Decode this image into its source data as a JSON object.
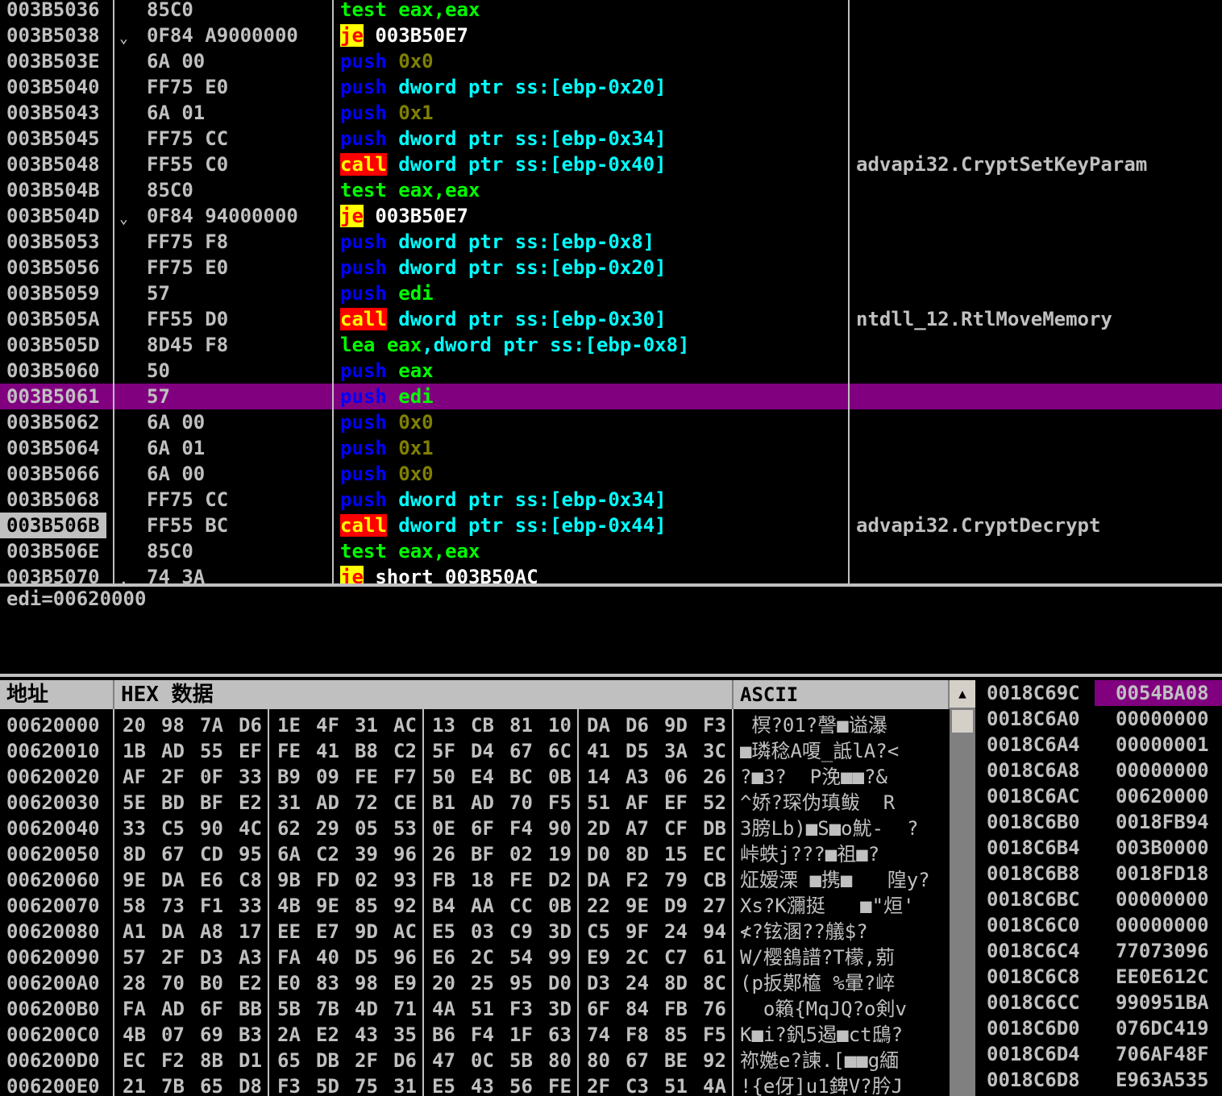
{
  "disasm": {
    "rows": [
      {
        "addr": "003B5036",
        "jmp": "",
        "hex": "85C0",
        "parts": [
          {
            "t": "test",
            "c": "op-test"
          },
          {
            "t": " "
          },
          {
            "t": "eax",
            "c": "reg"
          },
          {
            "t": ",",
            "c": "reg"
          },
          {
            "t": "eax",
            "c": "reg"
          }
        ],
        "comment": ""
      },
      {
        "addr": "003B5038",
        "jmp": "⌄",
        "hex": "0F84 A9000000",
        "parts": [
          {
            "t": "je",
            "c": "op-je"
          },
          {
            "t": " "
          },
          {
            "t": "003B50E7",
            "c": "lbl"
          }
        ],
        "comment": ""
      },
      {
        "addr": "003B503E",
        "jmp": "",
        "hex": "6A 00",
        "parts": [
          {
            "t": "push",
            "c": "op-push"
          },
          {
            "t": " "
          },
          {
            "t": "0x0",
            "c": "num"
          }
        ],
        "comment": ""
      },
      {
        "addr": "003B5040",
        "jmp": "",
        "hex": "FF75 E0",
        "parts": [
          {
            "t": "push",
            "c": "op-push"
          },
          {
            "t": " "
          },
          {
            "t": "dword ptr ss:[ebp-0x20]",
            "c": "mem"
          }
        ],
        "comment": ""
      },
      {
        "addr": "003B5043",
        "jmp": "",
        "hex": "6A 01",
        "parts": [
          {
            "t": "push",
            "c": "op-push"
          },
          {
            "t": " "
          },
          {
            "t": "0x1",
            "c": "num"
          }
        ],
        "comment": ""
      },
      {
        "addr": "003B5045",
        "jmp": "",
        "hex": "FF75 CC",
        "parts": [
          {
            "t": "push",
            "c": "op-push"
          },
          {
            "t": " "
          },
          {
            "t": "dword ptr ss:[ebp-0x34]",
            "c": "mem"
          }
        ],
        "comment": ""
      },
      {
        "addr": "003B5048",
        "jmp": "",
        "hex": "FF55 C0",
        "parts": [
          {
            "t": "call",
            "c": "op-call"
          },
          {
            "t": " "
          },
          {
            "t": "dword ptr ss:[ebp-0x40]",
            "c": "mem"
          }
        ],
        "comment": "advapi32.CryptSetKeyParam"
      },
      {
        "addr": "003B504B",
        "jmp": "",
        "hex": "85C0",
        "parts": [
          {
            "t": "test",
            "c": "op-test"
          },
          {
            "t": " "
          },
          {
            "t": "eax",
            "c": "reg"
          },
          {
            "t": ",",
            "c": "reg"
          },
          {
            "t": "eax",
            "c": "reg"
          }
        ],
        "comment": ""
      },
      {
        "addr": "003B504D",
        "jmp": "⌄",
        "hex": "0F84 94000000",
        "parts": [
          {
            "t": "je",
            "c": "op-je"
          },
          {
            "t": " "
          },
          {
            "t": "003B50E7",
            "c": "lbl"
          }
        ],
        "comment": ""
      },
      {
        "addr": "003B5053",
        "jmp": "",
        "hex": "FF75 F8",
        "parts": [
          {
            "t": "push",
            "c": "op-push"
          },
          {
            "t": " "
          },
          {
            "t": "dword ptr ss:[ebp-0x8]",
            "c": "mem"
          }
        ],
        "comment": ""
      },
      {
        "addr": "003B5056",
        "jmp": "",
        "hex": "FF75 E0",
        "parts": [
          {
            "t": "push",
            "c": "op-push"
          },
          {
            "t": " "
          },
          {
            "t": "dword ptr ss:[ebp-0x20]",
            "c": "mem"
          }
        ],
        "comment": ""
      },
      {
        "addr": "003B5059",
        "jmp": "",
        "hex": "57",
        "parts": [
          {
            "t": "push",
            "c": "op-push"
          },
          {
            "t": " "
          },
          {
            "t": "edi",
            "c": "reg"
          }
        ],
        "comment": ""
      },
      {
        "addr": "003B505A",
        "jmp": "",
        "hex": "FF55 D0",
        "parts": [
          {
            "t": "call",
            "c": "op-call"
          },
          {
            "t": " "
          },
          {
            "t": "dword ptr ss:[ebp-0x30]",
            "c": "mem"
          }
        ],
        "comment": "ntdll_12.RtlMoveMemory"
      },
      {
        "addr": "003B505D",
        "jmp": "",
        "hex": "8D45 F8",
        "parts": [
          {
            "t": "lea",
            "c": "op-lea"
          },
          {
            "t": " "
          },
          {
            "t": "eax",
            "c": "reg"
          },
          {
            "t": ",",
            "c": "mem"
          },
          {
            "t": "dword ptr ss:[ebp-0x8]",
            "c": "mem"
          }
        ],
        "comment": ""
      },
      {
        "addr": "003B5060",
        "jmp": "",
        "hex": "50",
        "parts": [
          {
            "t": "push",
            "c": "op-push"
          },
          {
            "t": " "
          },
          {
            "t": "eax",
            "c": "reg"
          }
        ],
        "comment": ""
      },
      {
        "addr": "003B5061",
        "jmp": "",
        "hex": "57",
        "parts": [
          {
            "t": "push",
            "c": "op-push"
          },
          {
            "t": " "
          },
          {
            "t": "edi",
            "c": "reg"
          }
        ],
        "comment": "",
        "selected": true
      },
      {
        "addr": "003B5062",
        "jmp": "",
        "hex": "6A 00",
        "parts": [
          {
            "t": "push",
            "c": "op-push"
          },
          {
            "t": " "
          },
          {
            "t": "0x0",
            "c": "num"
          }
        ],
        "comment": ""
      },
      {
        "addr": "003B5064",
        "jmp": "",
        "hex": "6A 01",
        "parts": [
          {
            "t": "push",
            "c": "op-push"
          },
          {
            "t": " "
          },
          {
            "t": "0x1",
            "c": "num"
          }
        ],
        "comment": ""
      },
      {
        "addr": "003B5066",
        "jmp": "",
        "hex": "6A 00",
        "parts": [
          {
            "t": "push",
            "c": "op-push"
          },
          {
            "t": " "
          },
          {
            "t": "0x0",
            "c": "num"
          }
        ],
        "comment": ""
      },
      {
        "addr": "003B5068",
        "jmp": "",
        "hex": "FF75 CC",
        "parts": [
          {
            "t": "push",
            "c": "op-push"
          },
          {
            "t": " "
          },
          {
            "t": "dword ptr ss:[ebp-0x34]",
            "c": "mem"
          }
        ],
        "comment": ""
      },
      {
        "addr": "003B506B",
        "jmp": "",
        "hex": "FF55 BC",
        "parts": [
          {
            "t": "call",
            "c": "op-call"
          },
          {
            "t": " "
          },
          {
            "t": "dword ptr ss:[ebp-0x44]",
            "c": "mem"
          }
        ],
        "comment": "advapi32.CryptDecrypt",
        "addr_highlight": true
      },
      {
        "addr": "003B506E",
        "jmp": "",
        "hex": "85C0",
        "parts": [
          {
            "t": "test",
            "c": "op-test"
          },
          {
            "t": " "
          },
          {
            "t": "eax",
            "c": "reg"
          },
          {
            "t": ",",
            "c": "reg"
          },
          {
            "t": "eax",
            "c": "reg"
          }
        ],
        "comment": ""
      },
      {
        "addr": "003B5070",
        "jmp": ".",
        "hex": "74 3A",
        "parts": [
          {
            "t": "je",
            "c": "op-je"
          },
          {
            "t": " "
          },
          {
            "t": "short 003B50AC",
            "c": "lbl"
          }
        ],
        "comment": ""
      }
    ]
  },
  "info": {
    "text": "edi=00620000"
  },
  "dump": {
    "headers": {
      "address": "地址",
      "hex": "HEX 数据",
      "ascii": "ASCII"
    },
    "rows": [
      {
        "addr": "00620000",
        "bytes": [
          "20",
          "98",
          "7A",
          "D6",
          "1E",
          "4F",
          "31",
          "AC",
          "13",
          "CB",
          "81",
          "10",
          "DA",
          "D6",
          "9D",
          "F3"
        ],
        "ascii": " 榠?01?謦■谥瀑"
      },
      {
        "addr": "00620010",
        "bytes": [
          "1B",
          "AD",
          "55",
          "EF",
          "FE",
          "41",
          "B8",
          "C2",
          "5F",
          "D4",
          "67",
          "6C",
          "41",
          "D5",
          "3A",
          "3C"
        ],
        "ascii": "■璘稔A嗄_詆lA?<"
      },
      {
        "addr": "00620020",
        "bytes": [
          "AF",
          "2F",
          "0F",
          "33",
          "B9",
          "09",
          "FE",
          "F7",
          "50",
          "E4",
          "BC",
          "0B",
          "14",
          "A3",
          "06",
          "26"
        ],
        "ascii": "?■3?  P浼■■?&"
      },
      {
        "addr": "00620030",
        "bytes": [
          "5E",
          "BD",
          "BF",
          "E2",
          "31",
          "AD",
          "72",
          "CE",
          "B1",
          "AD",
          "70",
          "F5",
          "51",
          "AF",
          "EF",
          "52"
        ],
        "ascii": "^娇?琛伪瑱鲅  R"
      },
      {
        "addr": "00620040",
        "bytes": [
          "33",
          "C5",
          "90",
          "4C",
          "62",
          "29",
          "05",
          "53",
          "0E",
          "6F",
          "F4",
          "90",
          "2D",
          "A7",
          "CF",
          "DB"
        ],
        "ascii": "3膀Lb)■S■o魷-  ?"
      },
      {
        "addr": "00620050",
        "bytes": [
          "8D",
          "67",
          "CD",
          "95",
          "6A",
          "C2",
          "39",
          "96",
          "26",
          "BF",
          "02",
          "19",
          "D0",
          "8D",
          "15",
          "EC"
        ],
        "ascii": "峠蛈j???■祖■?"
      },
      {
        "addr": "00620060",
        "bytes": [
          "9E",
          "DA",
          "E6",
          "C8",
          "9B",
          "FD",
          "02",
          "93",
          "FB",
          "18",
          "FE",
          "D2",
          "DA",
          "F2",
          "79",
          "CB"
        ],
        "ascii": "炡嫒溧 ■携■   隍y?"
      },
      {
        "addr": "00620070",
        "bytes": [
          "58",
          "73",
          "F1",
          "33",
          "4B",
          "9E",
          "85",
          "92",
          "B4",
          "AA",
          "CC",
          "0B",
          "22",
          "9E",
          "D9",
          "27"
        ],
        "ascii": "Xs?K瀰挺   ■\"烜'"
      },
      {
        "addr": "00620080",
        "bytes": [
          "A1",
          "DA",
          "A8",
          "17",
          "EE",
          "E7",
          "9D",
          "AC",
          "E5",
          "03",
          "C9",
          "3D",
          "C5",
          "9F",
          "24",
          "94"
        ],
        "ascii": "≮?铉溷??艤$?"
      },
      {
        "addr": "00620090",
        "bytes": [
          "57",
          "2F",
          "D3",
          "A3",
          "FA",
          "40",
          "D5",
          "96",
          "E6",
          "2C",
          "54",
          "99",
          "E9",
          "2C",
          "C7",
          "61"
        ],
        "ascii": "W/樱鵨譜?T檬,莂"
      },
      {
        "addr": "006200A0",
        "bytes": [
          "28",
          "70",
          "B0",
          "E2",
          "E0",
          "83",
          "98",
          "E9",
          "20",
          "25",
          "95",
          "D0",
          "D3",
          "24",
          "8D",
          "8C"
        ],
        "ascii": "(p扳鄚檶 %暈?崪"
      },
      {
        "addr": "006200B0",
        "bytes": [
          "FA",
          "AD",
          "6F",
          "BB",
          "5B",
          "7B",
          "4D",
          "71",
          "4A",
          "51",
          "F3",
          "3D",
          "6F",
          "84",
          "FB",
          "76"
        ],
        "ascii": "  o籟{MqJQ?o剣v"
      },
      {
        "addr": "006200C0",
        "bytes": [
          "4B",
          "07",
          "69",
          "B3",
          "2A",
          "E2",
          "43",
          "35",
          "B6",
          "F4",
          "1F",
          "63",
          "74",
          "F8",
          "85",
          "F5"
        ],
        "ascii": "K■i?釩5遏■ct鴟?"
      },
      {
        "addr": "006200D0",
        "bytes": [
          "EC",
          "F2",
          "8B",
          "D1",
          "65",
          "DB",
          "2F",
          "D6",
          "47",
          "0C",
          "5B",
          "80",
          "80",
          "67",
          "BE",
          "92"
        ],
        "ascii": "祢嬔e?諫.[■■g緬"
      },
      {
        "addr": "006200E0",
        "bytes": [
          "21",
          "7B",
          "65",
          "D8",
          "F3",
          "5D",
          "75",
          "31",
          "E5",
          "43",
          "56",
          "FE",
          "2F",
          "C3",
          "51",
          "4A"
        ],
        "ascii": "!{e伢]u1錍V?肣J"
      }
    ]
  },
  "scrollbar": {
    "up_arrow": "▲"
  },
  "stack": {
    "rows": [
      {
        "addr": "0018C69C",
        "val": "0054BA08"
      },
      {
        "addr": "0018C6A0",
        "val": "00000000"
      },
      {
        "addr": "0018C6A4",
        "val": "00000001"
      },
      {
        "addr": "0018C6A8",
        "val": "00000000"
      },
      {
        "addr": "0018C6AC",
        "val": "00620000"
      },
      {
        "addr": "0018C6B0",
        "val": "0018FB94"
      },
      {
        "addr": "0018C6B4",
        "val": "003B0000"
      },
      {
        "addr": "0018C6B8",
        "val": "0018FD18"
      },
      {
        "addr": "0018C6BC",
        "val": "00000000"
      },
      {
        "addr": "0018C6C0",
        "val": "00000000"
      },
      {
        "addr": "0018C6C4",
        "val": "77073096"
      },
      {
        "addr": "0018C6C8",
        "val": "EE0E612C"
      },
      {
        "addr": "0018C6CC",
        "val": "990951BA"
      },
      {
        "addr": "0018C6D0",
        "val": "076DC419"
      },
      {
        "addr": "0018C6D4",
        "val": "706AF48F"
      },
      {
        "addr": "0018C6D8",
        "val": "E963A535"
      }
    ]
  }
}
